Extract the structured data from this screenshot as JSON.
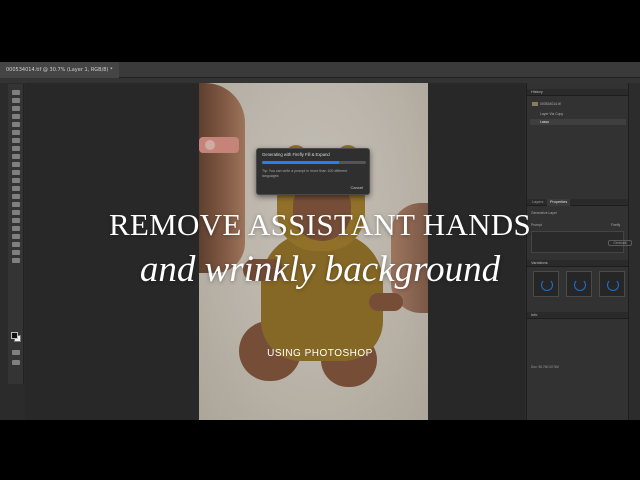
{
  "document": {
    "tab_label": "000534014.tif @ 30.7% (Layer 1, RGB/8) *"
  },
  "dialog": {
    "title": "Generating with Firefly Fill & Expand",
    "progress": 0.74,
    "tip": "Tip:  You can write a prompt in more than 100 different languages",
    "cancel_label": "Cancel"
  },
  "panels": {
    "history": {
      "title": "History",
      "items": [
        {
          "label": "000534014.tif",
          "active": false
        },
        {
          "label": "Layer Via Copy",
          "active": false
        },
        {
          "label": "Lasso",
          "active": true
        }
      ]
    },
    "properties": {
      "tabs": [
        "Layers",
        "Properties"
      ],
      "active_tab": "Properties",
      "layer_type": "Generative Layer",
      "prompt_label": "Prompt",
      "model_label": "Firefly",
      "generate_label": "Generate"
    },
    "variations": {
      "title": "Variations",
      "count": 3
    },
    "info": {
      "title": "Info",
      "footer": "Doc: 96.7M/137.5M"
    }
  },
  "overlay": {
    "title": "REMOVE ASSISTANT HANDS",
    "subtitle": "and wrinkly background",
    "caption": "USING PHOTOSHOP"
  },
  "colors": {
    "accent": "#2680eb",
    "app_bg": "#2b2b2b",
    "panel_bg": "#323232"
  }
}
